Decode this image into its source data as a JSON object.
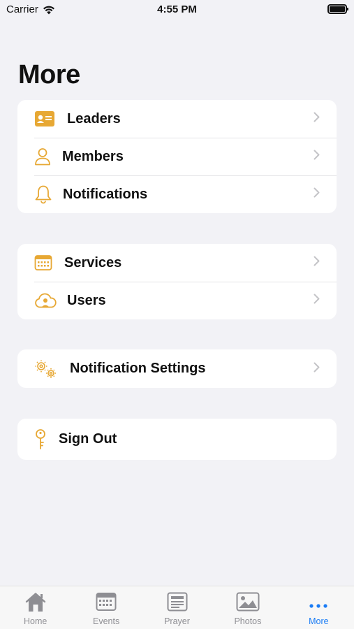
{
  "status_bar": {
    "carrier": "Carrier",
    "time": "4:55 PM"
  },
  "title": "More",
  "colors": {
    "accent": "#e7a834",
    "tab_active": "#1a7cf5",
    "tab_inactive": "#8e8e93"
  },
  "groups": [
    {
      "items": [
        {
          "label": "Leaders",
          "icon": "id-card-icon"
        },
        {
          "label": "Members",
          "icon": "person-icon"
        },
        {
          "label": "Notifications",
          "icon": "bell-icon"
        }
      ]
    },
    {
      "items": [
        {
          "label": "Services",
          "icon": "calendar-icon"
        },
        {
          "label": "Users",
          "icon": "cloud-person-icon"
        }
      ]
    },
    {
      "items": [
        {
          "label": "Notification Settings",
          "icon": "gears-icon"
        }
      ]
    },
    {
      "items": [
        {
          "label": "Sign Out",
          "icon": "key-icon"
        }
      ]
    }
  ],
  "tabs": [
    {
      "label": "Home",
      "icon": "house-icon"
    },
    {
      "label": "Events",
      "icon": "calendar-icon"
    },
    {
      "label": "Prayer",
      "icon": "newspaper-icon"
    },
    {
      "label": "Photos",
      "icon": "photo-icon"
    },
    {
      "label": "More",
      "icon": "ellipsis-icon",
      "active": true
    }
  ]
}
